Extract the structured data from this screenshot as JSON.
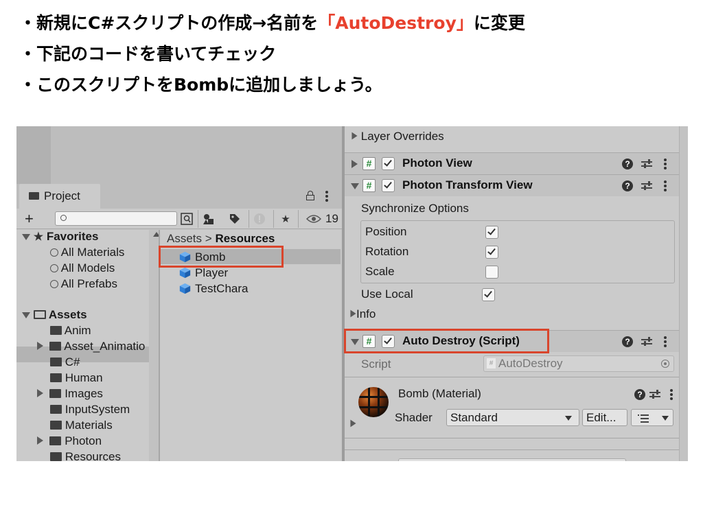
{
  "slide": {
    "bullets": [
      {
        "prefix": "・新規にC#スクリプトの作成→名前を",
        "highlight": "「AutoDestroy」",
        "suffix": "に変更"
      },
      {
        "prefix": "・下記のコードを書いてチェック",
        "highlight": "",
        "suffix": ""
      },
      {
        "prefix": "・このスクリプトをBombに追加しましょう。",
        "highlight": "",
        "suffix": ""
      }
    ],
    "highlight_color": "#e8412e"
  },
  "project": {
    "tab_label": "Project",
    "icons": {
      "add": "plus-icon",
      "lock": "lock-icon",
      "menu": "kebab-menu-icon"
    },
    "search": {
      "placeholder": "",
      "value": ""
    },
    "toolbar": {
      "plus_label": "+",
      "hidden_count": "19"
    },
    "tree": {
      "favorites_label": "Favorites",
      "favorites": [
        "All Materials",
        "All Models",
        "All Prefabs"
      ],
      "assets_label": "Assets",
      "folders": [
        {
          "name": "Anim",
          "expandable": false
        },
        {
          "name": "Asset_Animatio",
          "expandable": true
        },
        {
          "name": "C#",
          "expandable": false
        },
        {
          "name": "Human",
          "expandable": false
        },
        {
          "name": "Images",
          "expandable": true
        },
        {
          "name": "InputSystem",
          "expandable": false
        },
        {
          "name": "Materials",
          "expandable": false
        },
        {
          "name": "Photon",
          "expandable": true
        },
        {
          "name": "Resources",
          "expandable": false,
          "selected": true
        }
      ]
    },
    "breadcrumb": {
      "root": "Assets",
      "separator": ">",
      "current": "Resources"
    },
    "files": [
      {
        "name": "Bomb",
        "selected": true
      },
      {
        "name": "Player"
      },
      {
        "name": "TestChara"
      }
    ]
  },
  "inspector": {
    "layer_overrides": "Layer Overrides",
    "components": [
      {
        "title": "Photon View",
        "expanded": false
      },
      {
        "title": "Photon Transform View",
        "expanded": true
      },
      {
        "title": "Auto Destroy (Script)",
        "expanded": true,
        "highlighted": true
      }
    ],
    "sync_options_label": "Synchronize Options",
    "sync_options": [
      {
        "label": "Position",
        "checked": true
      },
      {
        "label": "Rotation",
        "checked": true
      },
      {
        "label": "Scale",
        "checked": false
      }
    ],
    "use_local": {
      "label": "Use Local",
      "checked": true
    },
    "info_label": "Info",
    "script_field": {
      "label": "Script",
      "value": "AutoDestroy"
    },
    "material": {
      "title": "Bomb (Material)",
      "shader_label": "Shader",
      "shader_value": "Standard",
      "edit_label": "Edit..."
    }
  },
  "colors": {
    "highlight_box": "#d9452c",
    "hash_icon": "#2a8a3a",
    "prefab_cube": "#2f7fd6"
  }
}
